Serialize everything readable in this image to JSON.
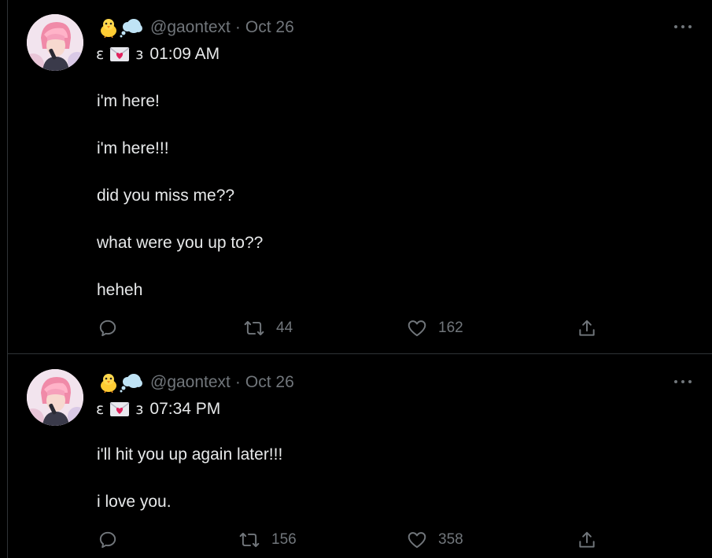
{
  "tweets": [
    {
      "display_emoji": [
        "chick-emoji",
        "thought-bubble-emoji"
      ],
      "handle": "@gaontext",
      "separator": "·",
      "date": "Oct 26",
      "name_left": "ɛ",
      "name_right": "ɜ",
      "time": "01:09 AM",
      "lines": [
        "i'm here!",
        "i'm here!!!",
        "did you miss me??",
        "what were you up to??",
        "heheh"
      ],
      "reply_count": "",
      "retweet_count": "44",
      "like_count": "162"
    },
    {
      "display_emoji": [
        "chick-emoji",
        "thought-bubble-emoji"
      ],
      "handle": "@gaontext",
      "separator": "·",
      "date": "Oct 26",
      "name_left": "ɛ",
      "name_right": "ɜ",
      "time": "07:34 PM",
      "lines": [
        "i'll hit you up again later!!!",
        "i love you."
      ],
      "reply_count": "",
      "retweet_count": "156",
      "like_count": "358"
    }
  ],
  "colors": {
    "background": "#000000",
    "text": "#e7e9ea",
    "secondary": "#71767b",
    "divider": "#2f3336"
  }
}
